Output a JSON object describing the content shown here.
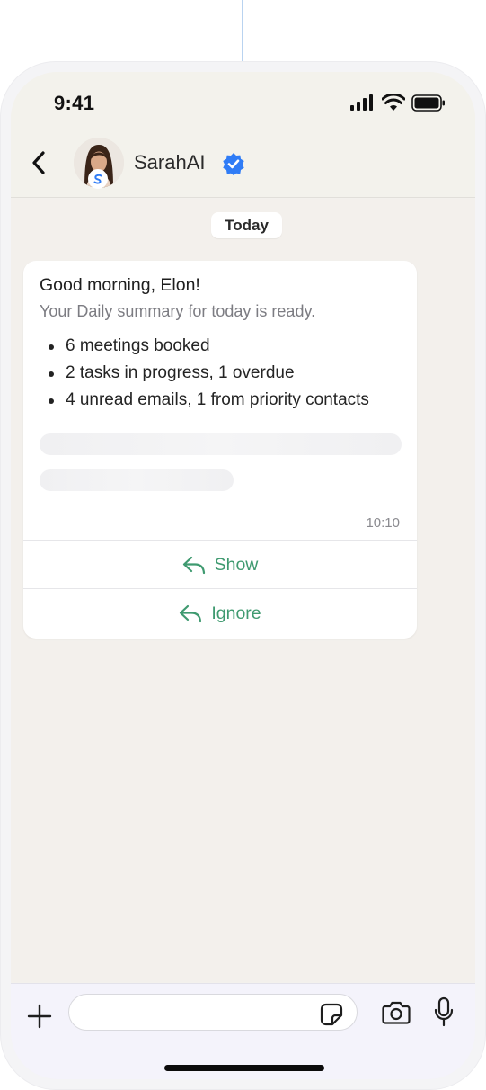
{
  "status_bar": {
    "time": "9:41"
  },
  "chat_header": {
    "contact_name": "SarahAI",
    "verified": true
  },
  "date_chip": "Today",
  "message": {
    "greeting": "Good morning, Elon!",
    "subtitle": "Your Daily summary for today is ready.",
    "bullets": [
      "6 meetings booked",
      "2 tasks in progress, 1 overdue",
      "4 unread emails, 1 from priority contacts"
    ],
    "time": "10:10",
    "actions": [
      {
        "label": "Show"
      },
      {
        "label": "Ignore"
      }
    ]
  },
  "composer": {
    "value": ""
  },
  "colors": {
    "accent_green": "#3f9a70",
    "verified_blue": "#2f7cf6",
    "chat_background": "#f3f0ec",
    "header_background": "#f3f2ec"
  }
}
